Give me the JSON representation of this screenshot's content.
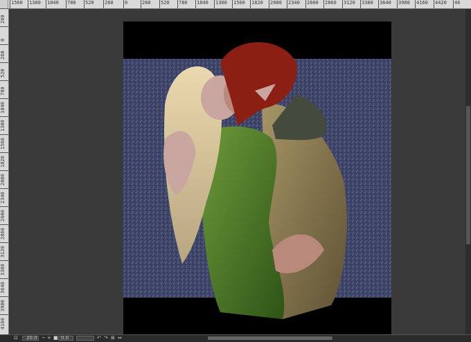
{
  "ruler": {
    "top_labels": [
      "1560",
      "1300",
      "1040",
      "780",
      "520",
      "260",
      "0",
      "260",
      "520",
      "780",
      "1040",
      "1300",
      "1560",
      "1820",
      "2080",
      "2340",
      "2600",
      "2860",
      "3120",
      "3380",
      "3640",
      "3900",
      "4160",
      "4420",
      "46"
    ],
    "left_labels": [
      "260",
      "0",
      "260",
      "520",
      "780",
      "1040",
      "1300",
      "1560",
      "1820",
      "2080",
      "2340",
      "2600",
      "2860",
      "3120",
      "3380",
      "3640",
      "3900",
      "4160"
    ]
  },
  "statusbar": {
    "zoom_value": "20.0",
    "rotation_value": "0.0"
  },
  "artwork": {
    "description_icon": "painting-canvas-icon"
  },
  "colors": {
    "background": "#3b3b3b",
    "canvas_bg": "#000000",
    "texture": "#3d4466",
    "green": "#4f7a2a",
    "hair_blond": "#d8c9a0",
    "hair_red": "#8c1f14",
    "tunic_tan": "#8a7a52"
  }
}
